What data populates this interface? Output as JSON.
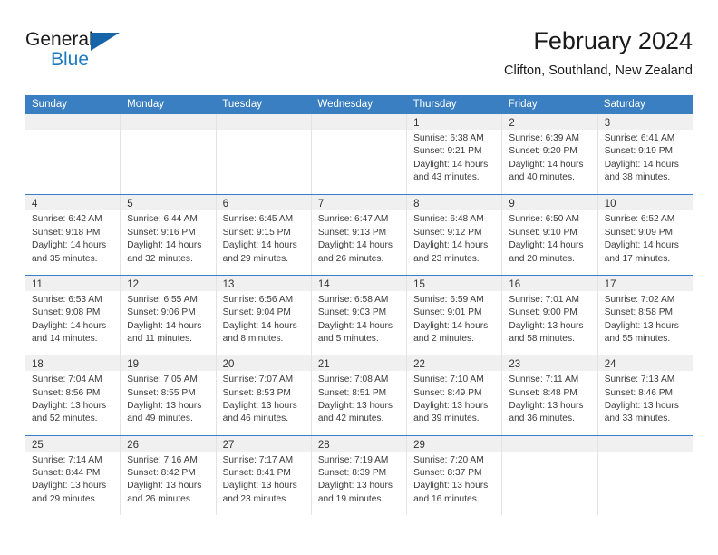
{
  "brand": {
    "name_part1": "General",
    "name_part2": "Blue",
    "logo_icon": "triangle-logo-icon",
    "accent_color": "#1c7ac0"
  },
  "header": {
    "title": "February 2024",
    "subtitle": "Clifton, Southland, New Zealand"
  },
  "calendar": {
    "header_bg_color": "#3a7fc1",
    "daynum_bg_color": "#f0f0f0",
    "weekdays": [
      "Sunday",
      "Monday",
      "Tuesday",
      "Wednesday",
      "Thursday",
      "Friday",
      "Saturday"
    ],
    "weeks": [
      [
        {
          "day": "",
          "sunrise": "",
          "sunset": "",
          "daylight1": "",
          "daylight2": ""
        },
        {
          "day": "",
          "sunrise": "",
          "sunset": "",
          "daylight1": "",
          "daylight2": ""
        },
        {
          "day": "",
          "sunrise": "",
          "sunset": "",
          "daylight1": "",
          "daylight2": ""
        },
        {
          "day": "",
          "sunrise": "",
          "sunset": "",
          "daylight1": "",
          "daylight2": ""
        },
        {
          "day": "1",
          "sunrise": "Sunrise: 6:38 AM",
          "sunset": "Sunset: 9:21 PM",
          "daylight1": "Daylight: 14 hours",
          "daylight2": "and 43 minutes."
        },
        {
          "day": "2",
          "sunrise": "Sunrise: 6:39 AM",
          "sunset": "Sunset: 9:20 PM",
          "daylight1": "Daylight: 14 hours",
          "daylight2": "and 40 minutes."
        },
        {
          "day": "3",
          "sunrise": "Sunrise: 6:41 AM",
          "sunset": "Sunset: 9:19 PM",
          "daylight1": "Daylight: 14 hours",
          "daylight2": "and 38 minutes."
        }
      ],
      [
        {
          "day": "4",
          "sunrise": "Sunrise: 6:42 AM",
          "sunset": "Sunset: 9:18 PM",
          "daylight1": "Daylight: 14 hours",
          "daylight2": "and 35 minutes."
        },
        {
          "day": "5",
          "sunrise": "Sunrise: 6:44 AM",
          "sunset": "Sunset: 9:16 PM",
          "daylight1": "Daylight: 14 hours",
          "daylight2": "and 32 minutes."
        },
        {
          "day": "6",
          "sunrise": "Sunrise: 6:45 AM",
          "sunset": "Sunset: 9:15 PM",
          "daylight1": "Daylight: 14 hours",
          "daylight2": "and 29 minutes."
        },
        {
          "day": "7",
          "sunrise": "Sunrise: 6:47 AM",
          "sunset": "Sunset: 9:13 PM",
          "daylight1": "Daylight: 14 hours",
          "daylight2": "and 26 minutes."
        },
        {
          "day": "8",
          "sunrise": "Sunrise: 6:48 AM",
          "sunset": "Sunset: 9:12 PM",
          "daylight1": "Daylight: 14 hours",
          "daylight2": "and 23 minutes."
        },
        {
          "day": "9",
          "sunrise": "Sunrise: 6:50 AM",
          "sunset": "Sunset: 9:10 PM",
          "daylight1": "Daylight: 14 hours",
          "daylight2": "and 20 minutes."
        },
        {
          "day": "10",
          "sunrise": "Sunrise: 6:52 AM",
          "sunset": "Sunset: 9:09 PM",
          "daylight1": "Daylight: 14 hours",
          "daylight2": "and 17 minutes."
        }
      ],
      [
        {
          "day": "11",
          "sunrise": "Sunrise: 6:53 AM",
          "sunset": "Sunset: 9:08 PM",
          "daylight1": "Daylight: 14 hours",
          "daylight2": "and 14 minutes."
        },
        {
          "day": "12",
          "sunrise": "Sunrise: 6:55 AM",
          "sunset": "Sunset: 9:06 PM",
          "daylight1": "Daylight: 14 hours",
          "daylight2": "and 11 minutes."
        },
        {
          "day": "13",
          "sunrise": "Sunrise: 6:56 AM",
          "sunset": "Sunset: 9:04 PM",
          "daylight1": "Daylight: 14 hours",
          "daylight2": "and 8 minutes."
        },
        {
          "day": "14",
          "sunrise": "Sunrise: 6:58 AM",
          "sunset": "Sunset: 9:03 PM",
          "daylight1": "Daylight: 14 hours",
          "daylight2": "and 5 minutes."
        },
        {
          "day": "15",
          "sunrise": "Sunrise: 6:59 AM",
          "sunset": "Sunset: 9:01 PM",
          "daylight1": "Daylight: 14 hours",
          "daylight2": "and 2 minutes."
        },
        {
          "day": "16",
          "sunrise": "Sunrise: 7:01 AM",
          "sunset": "Sunset: 9:00 PM",
          "daylight1": "Daylight: 13 hours",
          "daylight2": "and 58 minutes."
        },
        {
          "day": "17",
          "sunrise": "Sunrise: 7:02 AM",
          "sunset": "Sunset: 8:58 PM",
          "daylight1": "Daylight: 13 hours",
          "daylight2": "and 55 minutes."
        }
      ],
      [
        {
          "day": "18",
          "sunrise": "Sunrise: 7:04 AM",
          "sunset": "Sunset: 8:56 PM",
          "daylight1": "Daylight: 13 hours",
          "daylight2": "and 52 minutes."
        },
        {
          "day": "19",
          "sunrise": "Sunrise: 7:05 AM",
          "sunset": "Sunset: 8:55 PM",
          "daylight1": "Daylight: 13 hours",
          "daylight2": "and 49 minutes."
        },
        {
          "day": "20",
          "sunrise": "Sunrise: 7:07 AM",
          "sunset": "Sunset: 8:53 PM",
          "daylight1": "Daylight: 13 hours",
          "daylight2": "and 46 minutes."
        },
        {
          "day": "21",
          "sunrise": "Sunrise: 7:08 AM",
          "sunset": "Sunset: 8:51 PM",
          "daylight1": "Daylight: 13 hours",
          "daylight2": "and 42 minutes."
        },
        {
          "day": "22",
          "sunrise": "Sunrise: 7:10 AM",
          "sunset": "Sunset: 8:49 PM",
          "daylight1": "Daylight: 13 hours",
          "daylight2": "and 39 minutes."
        },
        {
          "day": "23",
          "sunrise": "Sunrise: 7:11 AM",
          "sunset": "Sunset: 8:48 PM",
          "daylight1": "Daylight: 13 hours",
          "daylight2": "and 36 minutes."
        },
        {
          "day": "24",
          "sunrise": "Sunrise: 7:13 AM",
          "sunset": "Sunset: 8:46 PM",
          "daylight1": "Daylight: 13 hours",
          "daylight2": "and 33 minutes."
        }
      ],
      [
        {
          "day": "25",
          "sunrise": "Sunrise: 7:14 AM",
          "sunset": "Sunset: 8:44 PM",
          "daylight1": "Daylight: 13 hours",
          "daylight2": "and 29 minutes."
        },
        {
          "day": "26",
          "sunrise": "Sunrise: 7:16 AM",
          "sunset": "Sunset: 8:42 PM",
          "daylight1": "Daylight: 13 hours",
          "daylight2": "and 26 minutes."
        },
        {
          "day": "27",
          "sunrise": "Sunrise: 7:17 AM",
          "sunset": "Sunset: 8:41 PM",
          "daylight1": "Daylight: 13 hours",
          "daylight2": "and 23 minutes."
        },
        {
          "day": "28",
          "sunrise": "Sunrise: 7:19 AM",
          "sunset": "Sunset: 8:39 PM",
          "daylight1": "Daylight: 13 hours",
          "daylight2": "and 19 minutes."
        },
        {
          "day": "29",
          "sunrise": "Sunrise: 7:20 AM",
          "sunset": "Sunset: 8:37 PM",
          "daylight1": "Daylight: 13 hours",
          "daylight2": "and 16 minutes."
        },
        {
          "day": "",
          "sunrise": "",
          "sunset": "",
          "daylight1": "",
          "daylight2": ""
        },
        {
          "day": "",
          "sunrise": "",
          "sunset": "",
          "daylight1": "",
          "daylight2": ""
        }
      ]
    ]
  }
}
